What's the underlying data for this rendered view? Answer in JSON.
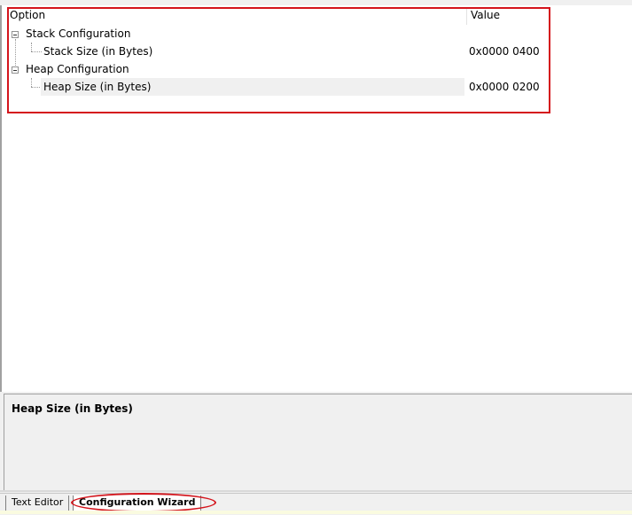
{
  "table": {
    "header_option": "Option",
    "header_value": "Value"
  },
  "tree": {
    "stack_group": "Stack Configuration",
    "stack_size_label": "Stack Size (in Bytes)",
    "stack_size_value": "0x0000 0400",
    "heap_group": "Heap Configuration",
    "heap_size_label": "Heap Size (in Bytes)",
    "heap_size_value": "0x0000 0200"
  },
  "description": {
    "title": "Heap Size (in Bytes)"
  },
  "tabs": {
    "text_editor": "Text Editor",
    "configuration_wizard": "Configuration Wizard"
  },
  "colors": {
    "highlight_red": "#d4141c",
    "selection_gray": "#f0f0f0"
  }
}
